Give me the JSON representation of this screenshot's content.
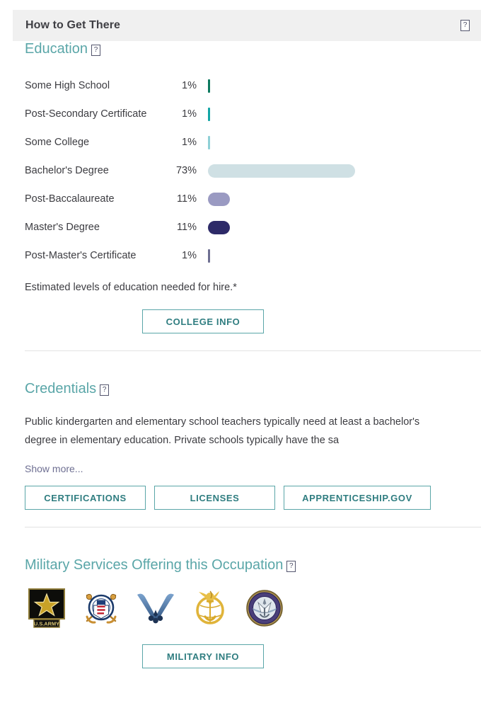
{
  "header": {
    "title": "How to Get There",
    "help_icon": "help-question-icon",
    "help_glyph": "?"
  },
  "education": {
    "section_title": "Education",
    "help_glyph": "?",
    "footnote": "Estimated levels of education needed for hire.*",
    "college_button": "COLLEGE INFO"
  },
  "chart_data": {
    "type": "bar",
    "title": "Education",
    "orientation": "horizontal",
    "xlabel": "",
    "ylabel": "",
    "xlim": [
      0,
      100
    ],
    "grid": false,
    "legend": "none",
    "value_suffix": "%",
    "categories": [
      "Some High School",
      "Post-Secondary Certificate",
      "Some College",
      "Bachelor's Degree",
      "Post-Baccalaureate",
      "Master's Degree",
      "Post-Master's Certificate"
    ],
    "values": [
      1,
      1,
      1,
      73,
      11,
      11,
      1
    ],
    "value_labels": [
      "1%",
      "1%",
      "1%",
      "73%",
      "11%",
      "11%",
      "1%"
    ],
    "colors": [
      "#0d7a5f",
      "#13a5a5",
      "#8fd0d6",
      "#cfe0e4",
      "#9a9ac2",
      "#2d2a68",
      "#6e6f92"
    ]
  },
  "credentials": {
    "section_title": "Credentials",
    "help_glyph": "?",
    "body": "Public kindergarten and elementary school teachers typically need at least a bachelor's\ndegree in elementary education. Private schools typically have the sa",
    "show_more": "Show more...",
    "buttons": [
      {
        "label": "CERTIFICATIONS",
        "name": "certifications-button"
      },
      {
        "label": "LICENSES",
        "name": "licenses-button"
      },
      {
        "label": "APPRENTICESHIP.GOV",
        "name": "apprenticeship-gov-button"
      }
    ]
  },
  "military": {
    "section_title": "Military Services Offering this Occupation",
    "help_glyph": "?",
    "branches": [
      {
        "name": "army-logo",
        "label": "U.S. ARMY"
      },
      {
        "name": "coast-guard-logo",
        "label": "Coast Guard"
      },
      {
        "name": "air-force-logo",
        "label": "Air Force"
      },
      {
        "name": "marine-corps-logo",
        "label": "Marine Corps"
      },
      {
        "name": "navy-logo",
        "label": "Navy"
      }
    ],
    "military_button": "MILITARY INFO"
  },
  "colors": {
    "accent_teal": "#5aa6a8",
    "button_text": "#2f7d80",
    "header_bg": "#f0f0f0",
    "body_text": "#3c3c41",
    "link": "#6e6f92"
  }
}
